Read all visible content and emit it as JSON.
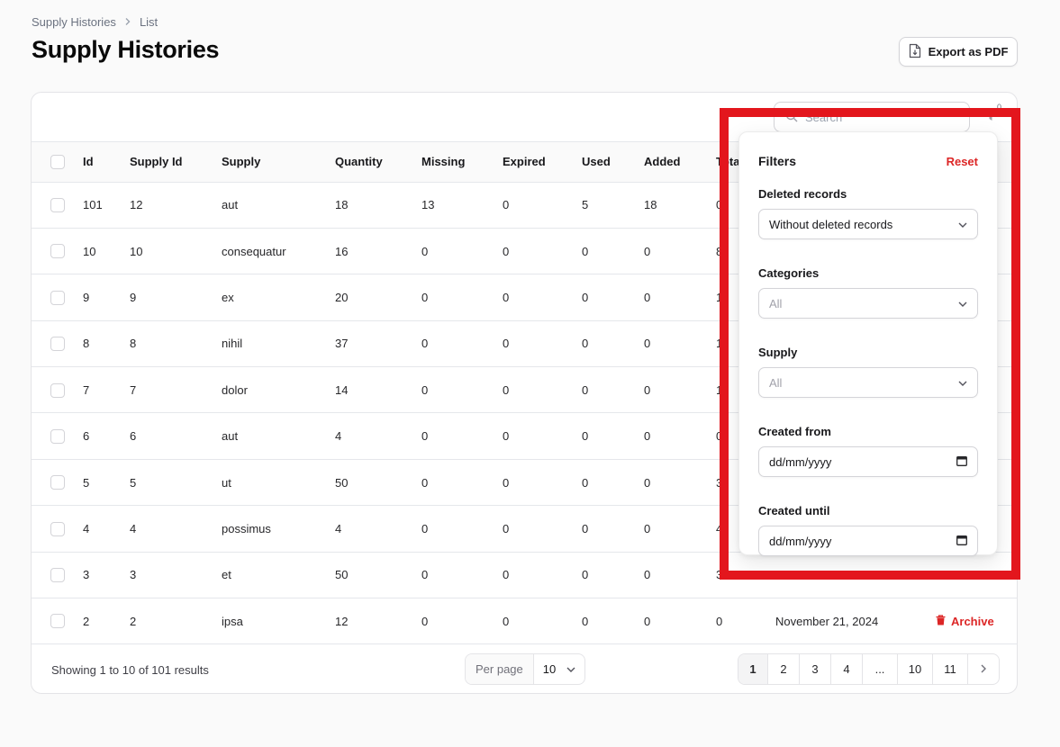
{
  "breadcrumb": {
    "parent": "Supply Histories",
    "separator": "›",
    "current": "List"
  },
  "page": {
    "title": "Supply Histories",
    "export_label": "Export as PDF"
  },
  "toolbar": {
    "search_placeholder": "Search",
    "filter_count": "0"
  },
  "table": {
    "columns": [
      "Id",
      "Supply Id",
      "Supply",
      "Quantity",
      "Missing",
      "Expired",
      "Used",
      "Added",
      "Total"
    ],
    "rows": [
      {
        "id": "101",
        "supply_id": "12",
        "supply": "aut",
        "quantity": "18",
        "missing": "13",
        "expired": "0",
        "used": "5",
        "added": "18",
        "total": "0",
        "date": "",
        "action": ""
      },
      {
        "id": "10",
        "supply_id": "10",
        "supply": "consequatur",
        "quantity": "16",
        "missing": "0",
        "expired": "0",
        "used": "0",
        "added": "0",
        "total": "8",
        "date": "",
        "action": ""
      },
      {
        "id": "9",
        "supply_id": "9",
        "supply": "ex",
        "quantity": "20",
        "missing": "0",
        "expired": "0",
        "used": "0",
        "added": "0",
        "total": "1",
        "date": "",
        "action": ""
      },
      {
        "id": "8",
        "supply_id": "8",
        "supply": "nihil",
        "quantity": "37",
        "missing": "0",
        "expired": "0",
        "used": "0",
        "added": "0",
        "total": "1",
        "date": "",
        "action": ""
      },
      {
        "id": "7",
        "supply_id": "7",
        "supply": "dolor",
        "quantity": "14",
        "missing": "0",
        "expired": "0",
        "used": "0",
        "added": "0",
        "total": "1",
        "date": "",
        "action": ""
      },
      {
        "id": "6",
        "supply_id": "6",
        "supply": "aut",
        "quantity": "4",
        "missing": "0",
        "expired": "0",
        "used": "0",
        "added": "0",
        "total": "0",
        "date": "",
        "action": ""
      },
      {
        "id": "5",
        "supply_id": "5",
        "supply": "ut",
        "quantity": "50",
        "missing": "0",
        "expired": "0",
        "used": "0",
        "added": "0",
        "total": "3",
        "date": "",
        "action": ""
      },
      {
        "id": "4",
        "supply_id": "4",
        "supply": "possimus",
        "quantity": "4",
        "missing": "0",
        "expired": "0",
        "used": "0",
        "added": "0",
        "total": "4",
        "date": "",
        "action": ""
      },
      {
        "id": "3",
        "supply_id": "3",
        "supply": "et",
        "quantity": "50",
        "missing": "0",
        "expired": "0",
        "used": "0",
        "added": "0",
        "total": "3",
        "date": "",
        "action": ""
      },
      {
        "id": "2",
        "supply_id": "2",
        "supply": "ipsa",
        "quantity": "12",
        "missing": "0",
        "expired": "0",
        "used": "0",
        "added": "0",
        "total": "0",
        "date": "November 21, 2024",
        "action": "Archive"
      }
    ]
  },
  "footer": {
    "showing": "Showing 1 to 10 of 101 results",
    "per_page_label": "Per page",
    "per_page_value": "10",
    "pages": [
      "1",
      "2",
      "3",
      "4",
      "...",
      "10",
      "11"
    ]
  },
  "filters": {
    "title": "Filters",
    "reset": "Reset",
    "deleted_label": "Deleted records",
    "deleted_value": "Without deleted records",
    "categories_label": "Categories",
    "categories_value": "All",
    "supply_label": "Supply",
    "supply_value": "All",
    "created_from_label": "Created from",
    "created_from_value": "dd/mm/yyyy",
    "created_until_label": "Created until",
    "created_until_value": "dd/mm/yyyy"
  },
  "colors": {
    "danger": "#dc2626",
    "highlight": "#e3161d"
  },
  "icons": [
    "chevron-right-icon",
    "file-download-icon",
    "search-icon",
    "funnel-icon",
    "trash-icon",
    "chevron-down-icon",
    "calendar-icon"
  ]
}
